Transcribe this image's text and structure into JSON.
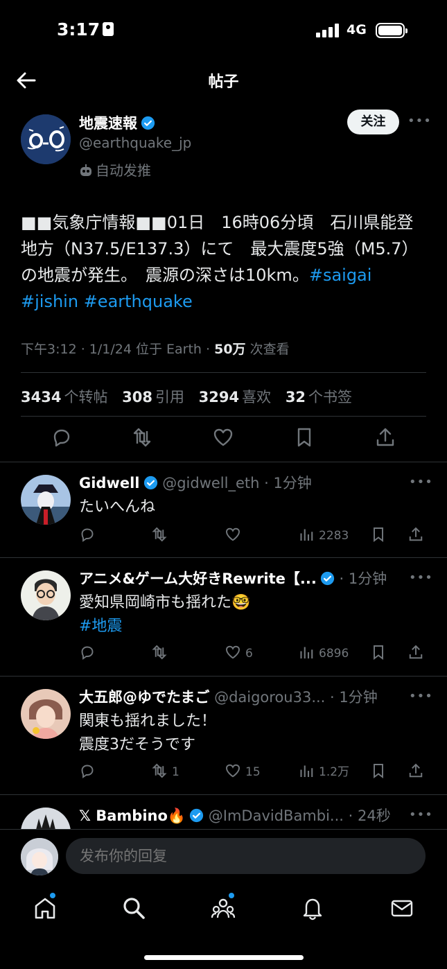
{
  "status_bar": {
    "time": "3:17",
    "network": "4G"
  },
  "nav": {
    "title": "帖子"
  },
  "main_tweet": {
    "author_name": "地震速報",
    "handle": "@earthquake_jp",
    "auto_label": "自动发推",
    "follow_label": "关注",
    "body_text": "■■気象庁情報■■01日　16時06分頃　石川県能登地方（N37.5/E137.3）にて　最大震度5強（M5.7）の地震が発生。　震源の深さは10km。",
    "hashtags": [
      "#saigai",
      "#jishin",
      "#earthquake"
    ],
    "meta_prefix": "下午3:12 · 1/1/24 位于 Earth · ",
    "views_count": "50万",
    "views_label": " 次查看",
    "stats": {
      "retweets": "3434",
      "retweets_label": "个转帖",
      "quotes": "308",
      "quotes_label": "引用",
      "likes": "3294",
      "likes_label": "喜欢",
      "bookmarks": "32",
      "bookmarks_label": "个书签"
    }
  },
  "replies": [
    {
      "name": "Gidwell",
      "handle_time": "@gidwell_eth · 1分钟",
      "text": "たいへんね",
      "retweets": "",
      "likes": "",
      "views": "2283"
    },
    {
      "name": "アニメ&ゲーム大好きRewrite【...",
      "handle_time": " · 1分钟",
      "text": "愛知県岡崎市も揺れた🤓",
      "hashtag": "#地震",
      "retweets": "",
      "likes": "6",
      "views": "6896"
    },
    {
      "name": "大五郎@ゆでたまご",
      "handle_time": "@daigorou33... · 1分钟",
      "text_line1": "関東も揺れました！",
      "text_line2": "震度3だそうです",
      "retweets": "1",
      "likes": "15",
      "views": "1.2万"
    },
    {
      "name_prefix": "𝕏 ",
      "name": "Bambino",
      "name_suffix": "🔥",
      "handle_time": "@ImDavidBambi... · 24秒"
    }
  ],
  "compose": {
    "placeholder": "发布你的回复"
  },
  "colors": {
    "accent": "#1d9bf0",
    "background": "#000000",
    "divider": "#2f3336",
    "muted": "#71767b"
  }
}
